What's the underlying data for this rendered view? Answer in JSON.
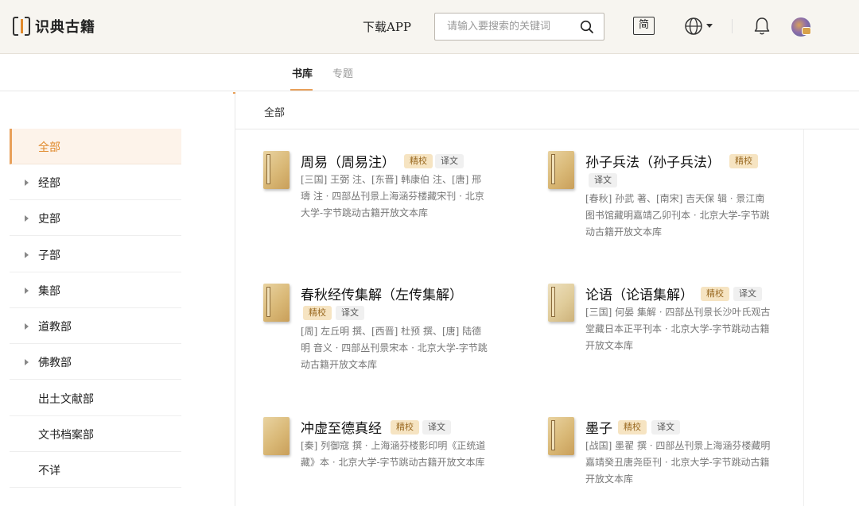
{
  "header": {
    "logo_text": "识典古籍",
    "download_label": "下载APP",
    "search_placeholder": "请输入要搜索的关键词",
    "lang_label": "简"
  },
  "tabs": [
    {
      "label": "书库",
      "active": true
    },
    {
      "label": "专题",
      "active": false
    }
  ],
  "sidebar": {
    "items": [
      {
        "label": "全部",
        "active": true
      },
      {
        "label": "经部",
        "expandable": true
      },
      {
        "label": "史部",
        "expandable": true
      },
      {
        "label": "子部",
        "expandable": true
      },
      {
        "label": "集部",
        "expandable": true
      },
      {
        "label": "道教部",
        "expandable": true
      },
      {
        "label": "佛教部",
        "expandable": true
      },
      {
        "label": "出土文献部",
        "expandable": false
      },
      {
        "label": "文书档案部",
        "expandable": false
      },
      {
        "label": "不详",
        "expandable": false
      }
    ]
  },
  "content": {
    "breadcrumb": "全部",
    "books": [
      {
        "title": "周易（周易注）",
        "badges": [
          "精校",
          "译文"
        ],
        "desc": "[三国] 王弼 注、[东晋] 韩康伯 注、[唐] 邢璹 注 · 四部丛刊景上海涵芬楼藏宋刊 · 北京大学-字节跳动古籍开放文本库"
      },
      {
        "title": "孙子兵法（孙子兵法）",
        "badges": [
          "精校",
          "译文"
        ],
        "desc": "[春秋] 孙武 著、[南宋] 吉天保 辑 · 景江南图书馆藏明嘉靖乙卯刊本 · 北京大学-字节跳动古籍开放文本库"
      },
      {
        "title": "春秋经传集解（左传集解）",
        "badges": [
          "精校",
          "译文"
        ],
        "desc": "[周] 左丘明 撰、[西晋] 杜预 撰、[唐] 陆德明 音义 · 四部丛刊景宋本 · 北京大学-字节跳动古籍开放文本库"
      },
      {
        "title": "论语（论语集解）",
        "badges": [
          "精校",
          "译文"
        ],
        "desc": "[三国] 何晏 集解 · 四部丛刊景长沙叶氏观古堂藏日本正平刊本 · 北京大学-字节跳动古籍开放文本库"
      },
      {
        "title": "冲虚至德真经",
        "badges": [
          "精校",
          "译文"
        ],
        "desc": "[秦] 列御寇 撰 · 上海涵芬楼影印明《正统道藏》本 · 北京大学-字节跳动古籍开放文本库"
      },
      {
        "title": "墨子",
        "badges": [
          "精校",
          "译文"
        ],
        "desc": "[战国] 墨翟 撰 · 四部丛刊景上海涵芬楼藏明嘉靖癸丑唐尧臣刊 · 北京大学-字节跳动古籍开放文本库"
      }
    ]
  },
  "colors": {
    "accent": "#e8a05a",
    "badge_gold_bg": "#f6e4c2",
    "header_bg": "#f7f5f0"
  }
}
